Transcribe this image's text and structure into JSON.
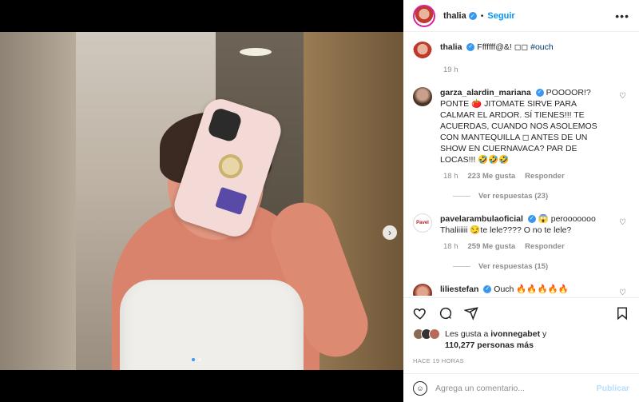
{
  "post": {
    "username": "thalia",
    "follow_label": "Seguir",
    "more_label": "•••",
    "caption_text": "Fffffff@&! ◻◻",
    "caption_hashtag": "#ouch",
    "caption_time": "19 h"
  },
  "comments": [
    {
      "username": "garza_alardin_mariana",
      "text": "POOOOR!? PONTE 🍅 JITOMATE SIRVE PARA CALMAR EL ARDOR. SÍ TIENES!!! TE ACUERDAS, CUANDO NOS ASOLEMOS CON MANTEQUILLA ◻ ANTES DE UN SHOW EN CUERNAVACA? PAR DE LOCAS!!! 🤣🤣🤣",
      "time": "18 h",
      "likes": "223 Me gusta",
      "reply_label": "Responder",
      "replies": "Ver respuestas (23)"
    },
    {
      "username": "pavelarambulaoficial",
      "text": "😱 perooooooo Thaliiiiii 😏te lele???? O no te lele?",
      "avatar_text": "Pavel",
      "time": "18 h",
      "likes": "259 Me gusta",
      "reply_label": "Responder",
      "replies": "Ver respuestas (15)"
    },
    {
      "username": "liliestefan",
      "text": "Ouch 🔥🔥🔥🔥🔥"
    }
  ],
  "likes": {
    "prefix": "Les gusta a",
    "user": "ivonnegabet",
    "suffix": "y",
    "count": "110,277 personas más"
  },
  "time_ago": "HACE 19 HORAS",
  "composer": {
    "placeholder": "Agrega un comentario...",
    "publish_label": "Publicar",
    "emoji": "☺"
  },
  "colors": {
    "accent": "#0095f6",
    "verified": "#3897f0",
    "publish_disabled": "#b2dffc"
  }
}
